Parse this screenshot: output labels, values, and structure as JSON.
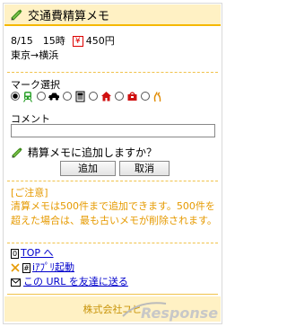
{
  "header": {
    "title": "交通費精算メモ"
  },
  "entry": {
    "date_time": "8/15　15時",
    "amount": "450円",
    "yen_symbol": "¥",
    "route": "東京→横浜"
  },
  "mark": {
    "label": "マーク選択",
    "icons": [
      "train-icon",
      "car-icon",
      "bus-icon",
      "building-icon",
      "bag-icon",
      "walk-icon"
    ]
  },
  "comment": {
    "label": "コメント",
    "value": ""
  },
  "confirm": {
    "question": "精算メモに追加しますか？",
    "add_label": "追加",
    "cancel_label": "取消"
  },
  "notice": {
    "title": "[ご注意]",
    "body": "清算メモは500件まで追加できます。500件を超えた場合は、最も古いメモが削除されます。"
  },
  "links": {
    "top_badge": "0",
    "top": "TOP へ",
    "iappli_badge": "#",
    "iappli": "iｱﾌﾟﾘ起動",
    "share": "この URL を友達に送る"
  },
  "footer": {
    "company": "株式会社ユビ"
  },
  "colors": {
    "accent": "#f5b800",
    "header_bg": "#fff1c4",
    "notice": "#e69a00",
    "link": "#0000cc"
  }
}
